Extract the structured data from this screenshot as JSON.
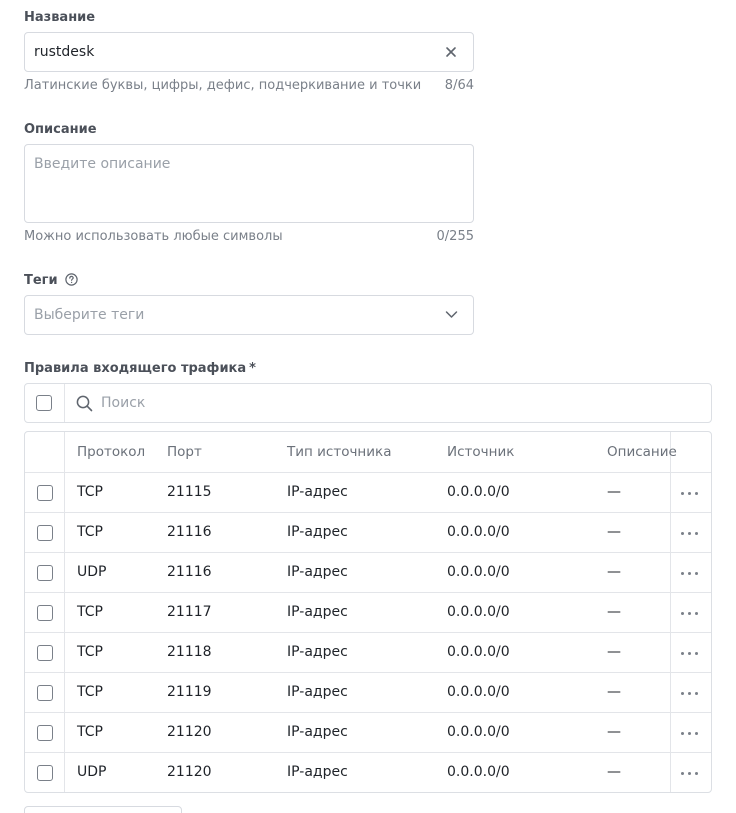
{
  "name_field": {
    "label": "Название",
    "value": "rustdesk",
    "hint": "Латинские буквы, цифры, дефис, подчеркивание и точки",
    "counter": "8/64"
  },
  "description_field": {
    "label": "Описание",
    "placeholder": "Введите описание",
    "hint": "Можно использовать любые символы",
    "counter": "0/255"
  },
  "tags_field": {
    "label": "Теги",
    "placeholder": "Выберите теги"
  },
  "rules": {
    "label": "Правила входящего трафика",
    "required_mark": "*",
    "search_placeholder": "Поиск",
    "columns": [
      "Протокол",
      "Порт",
      "Тип источника",
      "Источник",
      "Описание"
    ],
    "rows": [
      {
        "protocol": "TCP",
        "port": "21115",
        "source_type": "IP-адрес",
        "source": "0.0.0.0/0",
        "description": "—"
      },
      {
        "protocol": "TCP",
        "port": "21116",
        "source_type": "IP-адрес",
        "source": "0.0.0.0/0",
        "description": "—"
      },
      {
        "protocol": "UDP",
        "port": "21116",
        "source_type": "IP-адрес",
        "source": "0.0.0.0/0",
        "description": "—"
      },
      {
        "protocol": "TCP",
        "port": "21117",
        "source_type": "IP-адрес",
        "source": "0.0.0.0/0",
        "description": "—"
      },
      {
        "protocol": "TCP",
        "port": "21118",
        "source_type": "IP-адрес",
        "source": "0.0.0.0/0",
        "description": "—"
      },
      {
        "protocol": "TCP",
        "port": "21119",
        "source_type": "IP-адрес",
        "source": "0.0.0.0/0",
        "description": "—"
      },
      {
        "protocol": "TCP",
        "port": "21120",
        "source_type": "IP-адрес",
        "source": "0.0.0.0/0",
        "description": "—"
      },
      {
        "protocol": "UDP",
        "port": "21120",
        "source_type": "IP-адрес",
        "source": "0.0.0.0/0",
        "description": "—"
      }
    ]
  },
  "icons": {
    "clear": "close-icon",
    "help": "question-circle-icon",
    "dropdown": "chevron-down-icon",
    "search": "search-icon",
    "row_menu": "more-horizontal-icon"
  }
}
